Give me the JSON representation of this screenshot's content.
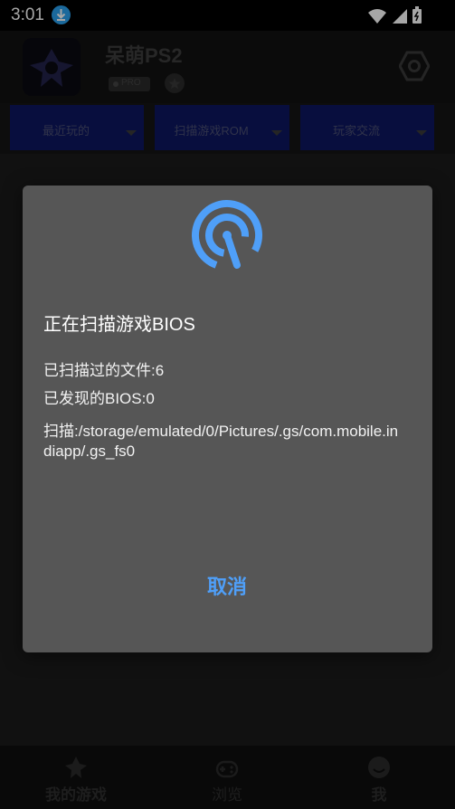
{
  "status_bar": {
    "time": "3:01",
    "icons": [
      "download-icon",
      "wifi-icon",
      "signal-icon",
      "battery-icon"
    ]
  },
  "header": {
    "title": "呆萌PS2",
    "badge": "PRO",
    "icons": [
      "app-logo-icon",
      "medal-icon",
      "settings-icon"
    ]
  },
  "tabs": [
    {
      "label": "最近玩的"
    },
    {
      "label": "扫描游戏ROM"
    },
    {
      "label": "玩家交流"
    }
  ],
  "dialog": {
    "title": "正在扫描游戏BIOS",
    "scanned_files": "已扫描过的文件:6",
    "found_bios": "已发现的BIOS:0",
    "scan_path": "扫描:/storage/emulated/0/Pictures/.gs/com.mobile.indiapp/.gs_fs0",
    "cancel_label": "取消",
    "accent_color": "#4f9ff8"
  },
  "bottom_nav": [
    {
      "label": "我的游戏",
      "icon": "games-icon"
    },
    {
      "label": "浏览",
      "icon": "gamepad-icon"
    },
    {
      "label": "我",
      "icon": "profile-icon"
    }
  ]
}
